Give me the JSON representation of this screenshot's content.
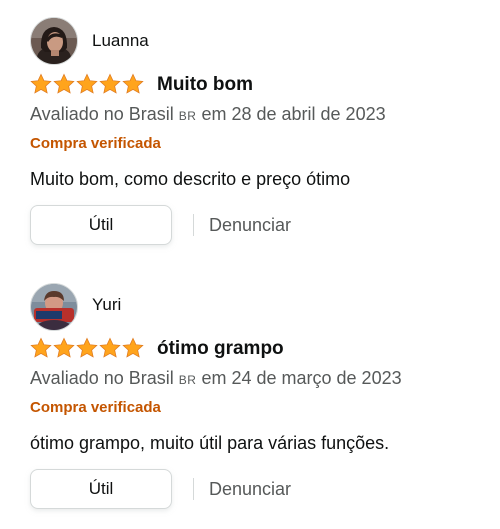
{
  "colors": {
    "star": "#ffa41c",
    "star_stroke": "#de7921",
    "verified": "#c45500",
    "meta_text": "#565959",
    "body_text": "#0f1111",
    "button_border": "#d5d9d9"
  },
  "reviews": [
    {
      "reviewer": "Luanna",
      "avatar_icon": "profile-photo",
      "rating": 5,
      "title": "Muito bom",
      "meta_prefix": "Avaliado no Brasil",
      "country_flag": "BR",
      "meta_suffix": "em 28 de abril de 2023",
      "verified": "Compra verificada",
      "body": "Muito bom, como descrito e preço ótimo",
      "helpful_label": "Útil",
      "report_label": "Denunciar"
    },
    {
      "reviewer": "Yuri",
      "avatar_icon": "profile-photo",
      "rating": 5,
      "title": "ótimo grampo",
      "meta_prefix": "Avaliado no Brasil",
      "country_flag": "BR",
      "meta_suffix": "em 24 de março de 2023",
      "verified": "Compra verificada",
      "body": "ótimo grampo, muito útil para várias funções.",
      "helpful_label": "Útil",
      "report_label": "Denunciar"
    }
  ]
}
